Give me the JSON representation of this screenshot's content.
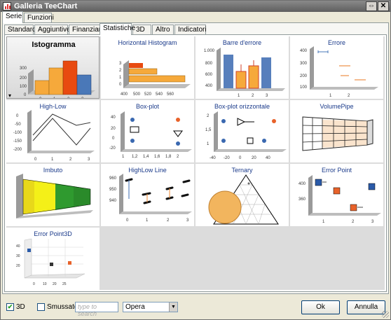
{
  "window": {
    "title": "Galleria TeeChart",
    "restore_symbol": "⇔",
    "close_symbol": "✕"
  },
  "top_tabs": [
    "Serie",
    "Funzioni"
  ],
  "sub_tabs": [
    "Standard",
    "Aggiuntive",
    "Finanziario",
    "Statistiche",
    "3D",
    "Altro",
    "Indicatori"
  ],
  "gallery": {
    "items": [
      {
        "title": "Istogramma",
        "selected": true
      },
      {
        "title": "Horizontal Histogram"
      },
      {
        "title": "Barre d'errore"
      },
      {
        "title": "Errore"
      },
      {
        "title": "High-Low"
      },
      {
        "title": "Box-plot"
      },
      {
        "title": "Box-plot orizzontale"
      },
      {
        "title": "VolumePipe"
      },
      {
        "title": "Imbuto"
      },
      {
        "title": "HighLow Line"
      },
      {
        "title": "Ternary"
      },
      {
        "title": "Error Point"
      },
      {
        "title": "Error Point3D"
      }
    ],
    "dropdown_glyph": "▾"
  },
  "footer": {
    "check3d": {
      "label": "3D",
      "checked": true
    },
    "smooth": {
      "label": "Smussato",
      "checked": false
    },
    "search_placeholder": "type to search",
    "theme_value": "Opera",
    "combo_arrow": "▼",
    "check_mark": "✔",
    "ok_label": "Ok",
    "cancel_label": "Annulla"
  }
}
